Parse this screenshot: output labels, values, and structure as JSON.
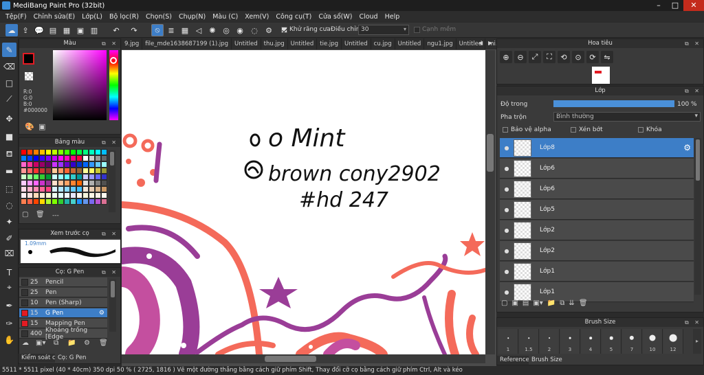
{
  "app": {
    "title": "MediBang Paint Pro (32bit)"
  },
  "menu": [
    "Tệp(F)",
    "Chỉnh sửa(E)",
    "Lớp(L)",
    "Bộ lọc(R)",
    "Chọn(S)",
    "Chụp(N)",
    "Màu (C)",
    "Xem(V)",
    "Công cụ(T)",
    "Cửa sổ(W)",
    "Cloud",
    "Help"
  ],
  "toolbar": {
    "antialias_label": "Khử răng cưa",
    "antialias_checked": true,
    "adjust_label": "Điều chỉnh",
    "adjust_value": "30",
    "strong_label": "Cạnh mềm"
  },
  "color_panel": {
    "title": "Màu",
    "r": "R:0",
    "g": "G:0",
    "b": "B:0",
    "hex": "#000000",
    "fg": "#000000",
    "bg": "#ffffff"
  },
  "palette_panel": {
    "title": "Bảng màu",
    "footer": "---"
  },
  "brush_preview": {
    "title": "Xem trước cọ",
    "size": "1.09mm"
  },
  "brush_panel": {
    "title": "Cọ: G Pen",
    "items": [
      {
        "size": "25",
        "name": "Pencil",
        "color": "#333333"
      },
      {
        "size": "25",
        "name": "Pen",
        "color": "#333333"
      },
      {
        "size": "10",
        "name": "Pen (Sharp)",
        "color": "#333333"
      },
      {
        "size": "15",
        "name": "G Pen",
        "color": "#e31b23"
      },
      {
        "size": "15",
        "name": "Mapping Pen",
        "color": "#e31b23"
      },
      {
        "size": "400",
        "name": "Khoảng trống [Edge",
        "color": "#333333"
      }
    ],
    "bottom_tabs": [
      "Kiểm soát cọ",
      "Cọ: G Pen"
    ]
  },
  "tabs": [
    "9.jpg",
    "file_mde1638687199 (1).jpg",
    "Untitled",
    "thu.jpg",
    "Untitled",
    "tie.jpg",
    "Untitled",
    "cu.jpg",
    "Untitled",
    "ngu1.jpg",
    "Untitled",
    "mi.jpg",
    "Untitled"
  ],
  "canvas_text": {
    "line1": "o Mint",
    "line2": "brown cony2902",
    "line3": "#hd 247"
  },
  "navigator": {
    "title": "Hoa tiêu"
  },
  "layers_panel": {
    "title": "Lớp",
    "opacity_label": "Độ trong",
    "opacity_value": "100 %",
    "opacity": 1.0,
    "blend_label": "Pha trộn",
    "blend_value": "Bình thường",
    "protect_alpha": "Bảo vệ alpha",
    "clipping": "Xén bớt",
    "lock": "Khóa",
    "layers": [
      "Lớp8",
      "Lớp6",
      "Lớp6",
      "Lớp5",
      "Lớp2",
      "Lớp2",
      "Lớp1",
      "Lớp1"
    ]
  },
  "brush_size_panel": {
    "title": "Brush Size",
    "sizes": [
      "1",
      "1.5",
      "2",
      "3",
      "4",
      "5",
      "7",
      "10",
      "12"
    ],
    "tabs": [
      "Reference",
      "Brush Size"
    ]
  },
  "status": {
    "text": "5511 * 5511 pixel  (40 * 40cm)  350 dpi  50 %  ( 2725, 1816 )  Vẽ một đường thẳng bằng cách giữ phím Shift, Thay đổi cỡ cọ bằng cách giữ phím Ctrl, Alt và kéo"
  },
  "colors": {
    "accent": "#3d7ec7",
    "purple": "#9a3d97",
    "orange": "#f46a5a"
  }
}
